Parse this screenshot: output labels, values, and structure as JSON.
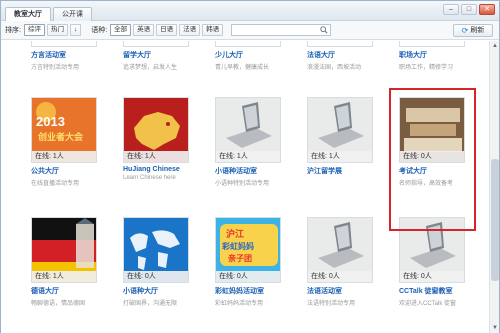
{
  "tabs": [
    {
      "label": "教室大厅"
    },
    {
      "label": "公开课"
    }
  ],
  "toolbar": {
    "sort_label": "排序:",
    "sort_buttons": [
      "综评",
      "热门",
      "↓"
    ],
    "lang_label": "语种:",
    "lang_buttons": [
      "全部",
      "英语",
      "日语",
      "法语",
      "韩语"
    ],
    "refresh_label": "刷新"
  },
  "top_row": [
    {
      "name": "方言活动室",
      "desc": "方言特别活动专用"
    },
    {
      "name": "留学大厅",
      "desc": "追求梦想，启发人生"
    },
    {
      "name": "少儿大厅",
      "desc": "青儿早教，健康成长"
    },
    {
      "name": "法语大厅",
      "desc": "浪漫法国，西坡活动"
    },
    {
      "name": "职场大厅",
      "desc": "职场工作，精修学习"
    }
  ],
  "row2": [
    {
      "name": "公共大厅",
      "desc": "在线直播活动专用",
      "online": "在线:  1人",
      "thumb": "2013 创业者大会"
    },
    {
      "name": "HuJiang Chinese",
      "desc": "Learn Chinese here",
      "online": "在线:  1人",
      "thumb": "china-map"
    },
    {
      "name": "小语种活动室",
      "desc": "小语种特别活动专用",
      "online": "在线:  1人",
      "thumb": "laptop"
    },
    {
      "name": "沪江留学展",
      "desc": "",
      "online": "在线:  1人",
      "thumb": "laptop"
    },
    {
      "name": "考试大厅",
      "desc": "名师指导，高效备考",
      "online": "在线:  0人",
      "thumb": "books"
    }
  ],
  "row3": [
    {
      "name": "德语大厅",
      "desc": "畅聊德语，情品德国",
      "online": "在线:  1人",
      "thumb": "germany"
    },
    {
      "name": "小语种大厅",
      "desc": "打破国界，沟通无限",
      "online": "在线:  0人",
      "thumb": "world-map"
    },
    {
      "name": "彩虹妈妈活动室",
      "desc": "彩虹妈妈活动专用",
      "online": "在线:  0人",
      "thumb": "沪江 彩虹妈妈 亲子团"
    },
    {
      "name": "法语活动室",
      "desc": "法语特别活动专用",
      "online": "在线:  0人",
      "thumb": "laptop"
    },
    {
      "name": "CCTalk 徒窗教室",
      "desc": "欢迎进入CCTalk 徒窗",
      "online": "在线:  0人",
      "thumb": "laptop"
    }
  ],
  "icons": {
    "refresh": "refresh-icon",
    "search": "search-icon"
  },
  "colors": {
    "accent": "#1a5fb4",
    "highlight": "#d6232c"
  }
}
